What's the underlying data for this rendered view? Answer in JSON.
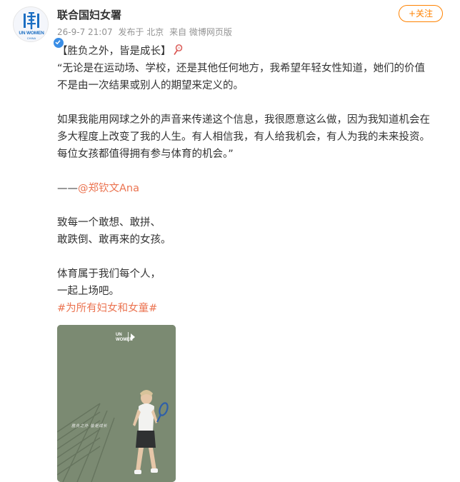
{
  "account": {
    "name": "联合国妇女署",
    "logo_text": "UN WOMEN",
    "logo_sub": "CHINA",
    "verified": true
  },
  "post_meta": {
    "datetime": "26-9-7 21:07",
    "location": "发布于 北京",
    "source": "来自 微博网页版"
  },
  "follow_button": {
    "label": "+关注"
  },
  "content": {
    "title": "【胜负之外，皆是成长】",
    "quote_lines": [
      "“无论是在运动场、学校，还是其他任何地方，我希望年轻女性知道，她们的价值",
      "不是由一次结果或别人的期望来定义的。",
      "如果我能用网球之外的声音来传递这个信息，我很愿意这么做，因为我知道机会在",
      "多大程度上改变了我的人生。有人相信我，有人给我机会，有人为我的未来投资。",
      "每位女孩都值得拥有参与体育的机会。”"
    ],
    "attribution_dash": "——",
    "mention": "@郑钦文Ana",
    "dedication_lines": [
      "致每一个敢想、敢拼、",
      "敢跌倒、敢再来的女孩。"
    ],
    "closing_lines": [
      "体育属于我们每个人，",
      "一起上场吧。"
    ],
    "hashtag": "#为所有妇女和女童#"
  },
  "media": {
    "brand_line1": "UN",
    "brand_line2": "WOMEN",
    "caption": "胜负之外 皆是成长"
  },
  "colors": {
    "accent": "#ff8200",
    "link": "#eb7350",
    "meta": "#939393",
    "text": "#333333",
    "verified": "#3a8ee6"
  },
  "icons": [
    "un-women-logo-icon",
    "verified-badge-icon",
    "tennis-racket-icon"
  ]
}
